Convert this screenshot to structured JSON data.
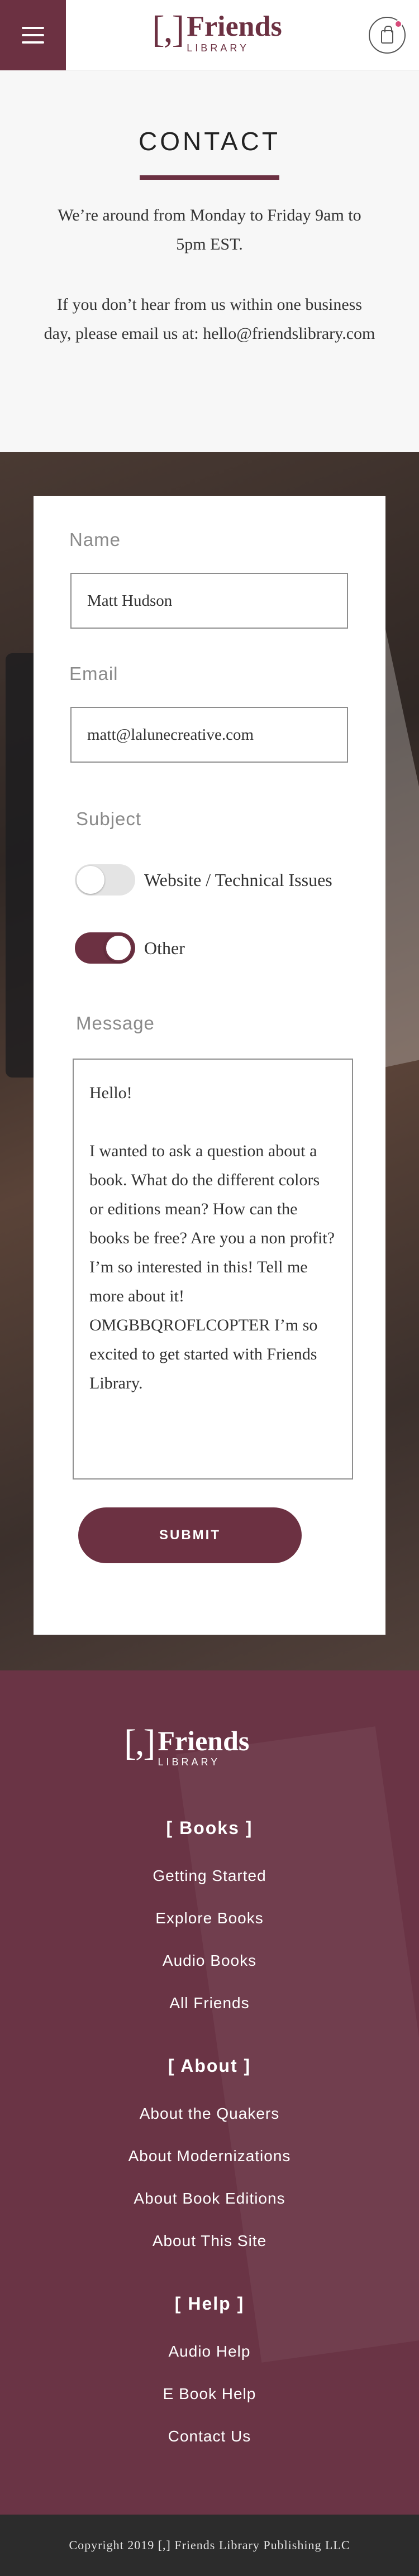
{
  "header": {
    "logo_bracket": "[,]",
    "logo_word1": "Friends",
    "logo_word2": "LIBRARY"
  },
  "contact": {
    "title": "CONTACT",
    "paragraph1": "We’re around from Monday to Friday 9am to 5pm EST.",
    "paragraph2": "If you don’t hear from us within one business day, please email us at: hello@friendslibrary.com"
  },
  "form": {
    "name_label": "Name",
    "name_value": "Matt Hudson",
    "email_label": "Email",
    "email_value": "matt@lalunecreative.com",
    "subject_label": "Subject",
    "subject_options": [
      {
        "label": "Website / Technical Issues",
        "selected": false
      },
      {
        "label": "Other",
        "selected": true
      }
    ],
    "message_label": "Message",
    "message_value": "Hello!\n\nI wanted to ask a question about a book. What do the different colors or editions mean? How can the books be free? Are you a non profit? I’m so interested in this! Tell me more about it! OMGBBQROFLCOPTER I’m so excited to get started with Friends Library.",
    "submit_label": "SUBMIT"
  },
  "footer": {
    "logo_bracket": "[,]",
    "logo_word1": "Friends",
    "logo_word2": "LIBRARY",
    "sections": [
      {
        "heading": "[ Books ]",
        "links": [
          "Getting Started",
          "Explore Books",
          "Audio Books",
          "All Friends"
        ]
      },
      {
        "heading": "[ About ]",
        "links": [
          "About the Quakers",
          "About Modernizations",
          "About Book Editions",
          "About This Site"
        ]
      },
      {
        "heading": "[ Help ]",
        "links": [
          "Audio Help",
          "E Book Help",
          "Contact Us"
        ]
      }
    ],
    "copyright": "Copyright 2019 [,] Friends Library Publishing LLC"
  },
  "colors": {
    "brand": "#6c3142",
    "footer_bg": "#6a3445",
    "copyright_bg": "#2c2c2c",
    "cart_badge": "#d74b7a"
  }
}
